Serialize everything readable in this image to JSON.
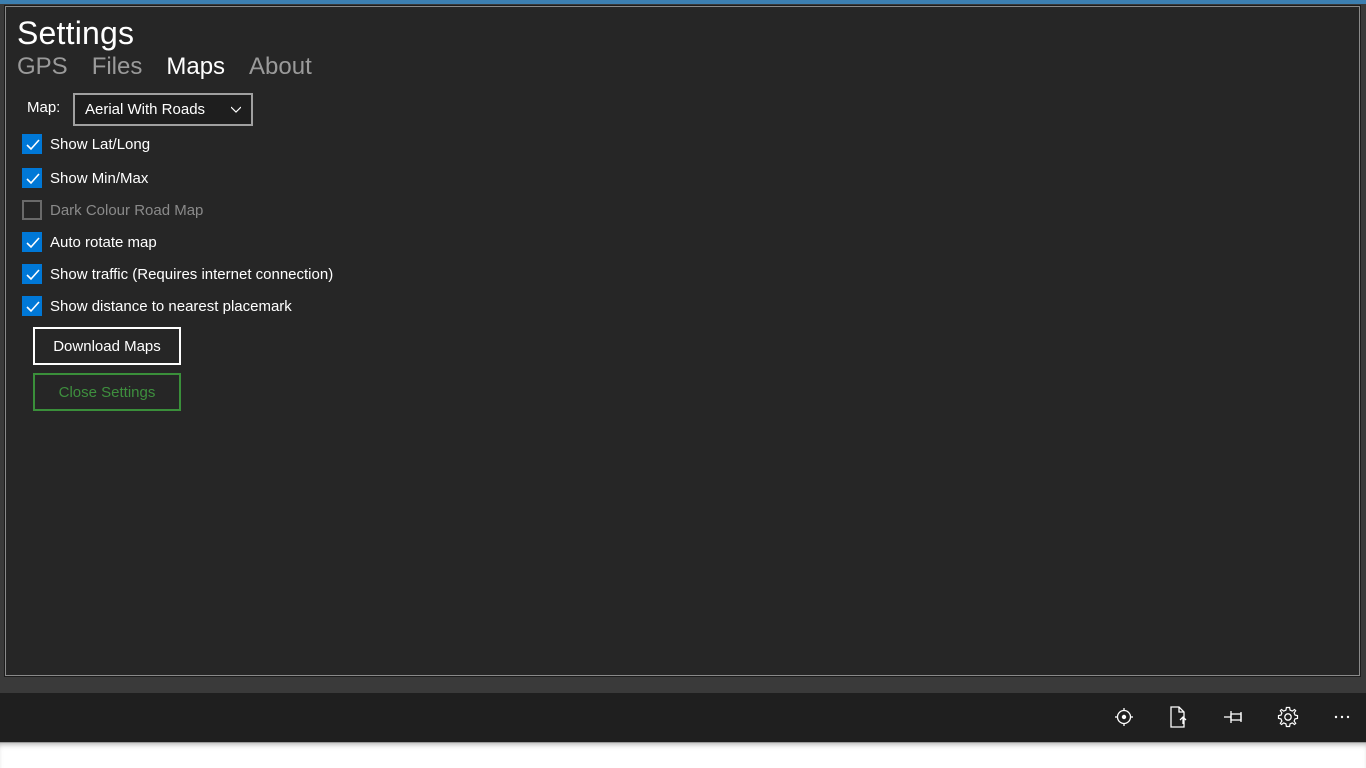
{
  "settings": {
    "title": "Settings",
    "tabs": [
      {
        "label": "GPS",
        "active": false
      },
      {
        "label": "Files",
        "active": false
      },
      {
        "label": "Maps",
        "active": true
      },
      {
        "label": "About",
        "active": false
      }
    ],
    "map_label": "Map:",
    "map_select_value": "Aerial With Roads",
    "options": [
      {
        "label": "Show Lat/Long",
        "checked": true,
        "enabled": true
      },
      {
        "label": "Show Min/Max",
        "checked": true,
        "enabled": true
      },
      {
        "label": "Dark Colour Road Map",
        "checked": false,
        "enabled": false
      },
      {
        "label": "Auto rotate map",
        "checked": true,
        "enabled": true
      },
      {
        "label": "Show traffic (Requires internet connection)",
        "checked": true,
        "enabled": true
      },
      {
        "label": "Show distance to nearest placemark",
        "checked": true,
        "enabled": true
      }
    ],
    "download_button": "Download Maps",
    "close_button": "Close Settings"
  },
  "appbar": {
    "icons": [
      "locate-icon",
      "export-file-icon",
      "pin-icon",
      "gear-icon",
      "more-icon"
    ],
    "more_label": "..."
  },
  "colors": {
    "accent": "#0078d7",
    "panel_bg": "#262626",
    "close_green": "#3a8f3a"
  }
}
